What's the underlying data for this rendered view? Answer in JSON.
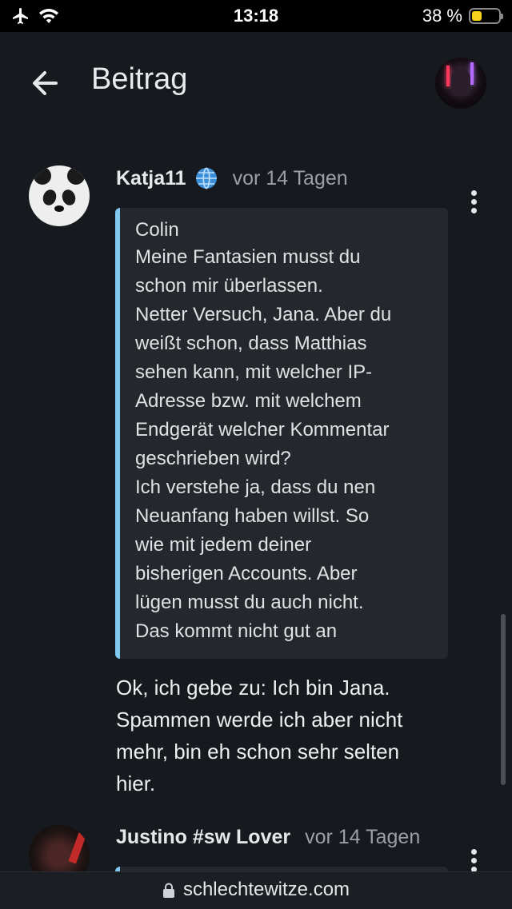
{
  "status_bar": {
    "time": "13:18",
    "battery": "38 %",
    "battery_level": 0.38,
    "icons": [
      "airplane-icon",
      "wifi-icon",
      "battery-icon"
    ]
  },
  "header": {
    "title": "Beitrag",
    "back_icon": "arrow-left-icon",
    "avatar_icon": "user-avatar"
  },
  "posts": [
    {
      "author": "Katja11",
      "badge_icon": "globe-icon",
      "time": "vor 14 Tagen",
      "quote": {
        "author": "Colin",
        "lines": [
          "Meine Fantasien musst du",
          "schon mir überlassen.",
          "Netter Versuch, Jana. Aber du",
          "weißt schon, dass Matthias",
          "sehen kann, mit welcher IP-",
          "Adresse bzw. mit welchem",
          "Endgerät welcher Kommentar",
          "geschrieben wird?",
          "Ich verstehe ja, dass du nen",
          "Neuanfang haben willst. So",
          "wie mit jedem deiner",
          "bisherigen Accounts. Aber",
          "lügen musst du auch nicht.",
          "Das kommt nicht gut an"
        ]
      },
      "body_lines": [
        "Ok, ich gebe zu: Ich bin Jana.",
        "Spammen werde ich aber nicht",
        "mehr, bin eh schon sehr selten",
        "hier."
      ]
    },
    {
      "author": "Justino #sw Lover",
      "time": "vor 14 Tagen"
    }
  ],
  "browser": {
    "url": "schlechtewitze.com",
    "lock_icon": "lock-icon"
  },
  "colors": {
    "background": "#16191d",
    "quote_background": "#24282d",
    "quote_accent": "#7fc8f0",
    "battery": "#f5d31a"
  }
}
